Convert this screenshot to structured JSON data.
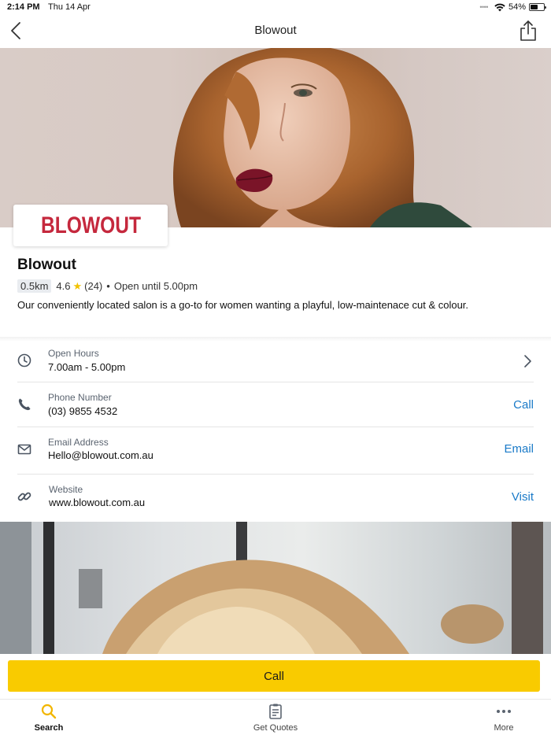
{
  "status_bar": {
    "time": "2:14 PM",
    "date": "Thu 14 Apr",
    "battery": "54%",
    "battery_level": 0.54
  },
  "nav": {
    "title": "Blowout",
    "back_icon": "chevron-left-icon",
    "share_icon": "share-icon"
  },
  "business": {
    "logo_text": "BLOWOUT",
    "logo_color": "#c5283d",
    "name": "Blowout",
    "distance": "0.5km",
    "rating": "4.6",
    "review_count": "(24)",
    "separator": "•",
    "open_status": "Open until 5.00pm",
    "description": "Our conveniently located salon is a go-to for women wanting a playful, low-maintenace cut & colour."
  },
  "contact": {
    "hours": {
      "label": "Open Hours",
      "value": "7.00am - 5.00pm"
    },
    "phone": {
      "label": "Phone Number",
      "value": "(03) 9855 4532",
      "action": "Call"
    },
    "email": {
      "label": "Email Address",
      "value": "Hello@blowout.com.au",
      "action": "Email"
    },
    "website": {
      "label": "Website",
      "value": "www.blowout.com.au",
      "action": "Visit"
    }
  },
  "cta": {
    "call_label": "Call",
    "color": "#f9cb00"
  },
  "tabs": [
    {
      "label": "Search",
      "icon": "search-icon",
      "active": true
    },
    {
      "label": "Get Quotes",
      "icon": "clipboard-icon",
      "active": false
    },
    {
      "label": "More",
      "icon": "more-icon",
      "active": false
    }
  ],
  "colors": {
    "accent": "#1a7ac8",
    "brand": "#c5283d",
    "cta": "#f9cb00"
  }
}
